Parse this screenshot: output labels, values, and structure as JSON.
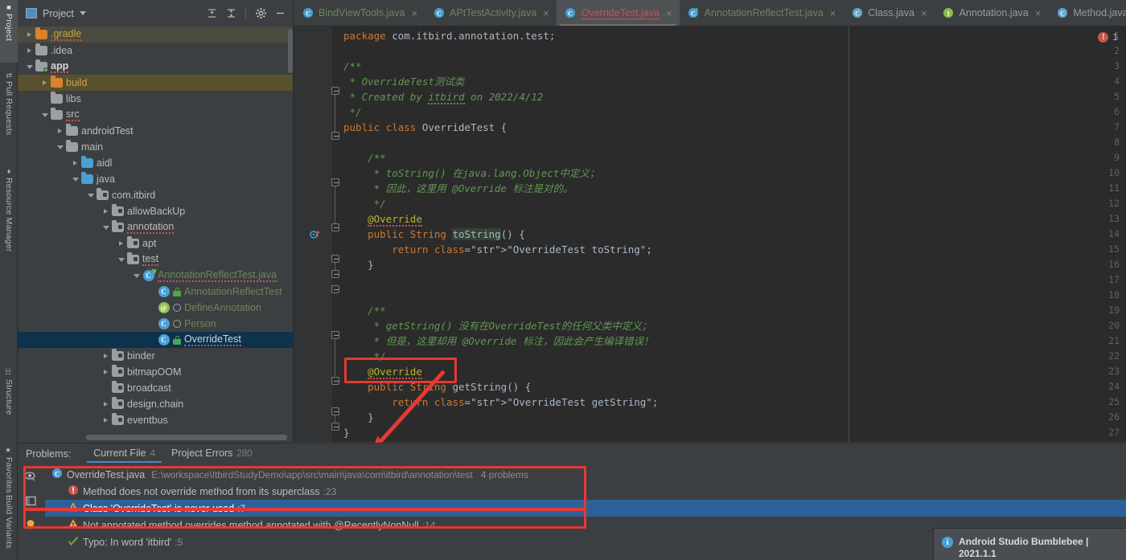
{
  "left_strip": [
    {
      "label": "Project",
      "icon": "project-icon",
      "selected": true
    },
    {
      "label": "Pull Requests",
      "icon": "pull-request-icon",
      "selected": false
    },
    {
      "label": "Resource Manager",
      "icon": "resource-manager-icon",
      "selected": false
    },
    {
      "label": "Structure",
      "icon": "structure-icon",
      "selected": false
    },
    {
      "label": "Favorites",
      "icon": "star-icon",
      "selected": false
    },
    {
      "label": "Build Variants",
      "icon": "build-variants-icon",
      "selected": false
    }
  ],
  "project_panel": {
    "title": "Project",
    "tools": [
      "expand-all-icon",
      "collapse-all-icon",
      "settings-gear-icon",
      "minimize-icon"
    ],
    "root": {
      "name": "ItbirdStudyDemo",
      "path": "E:\\workspace\\ItbirdStudyDemo"
    },
    "tree": [
      {
        "label": ".gradle",
        "indent": 0,
        "arrow": "closed",
        "icon": "folder-orange",
        "color": "gold",
        "row": "hl-project"
      },
      {
        "label": ".idea",
        "indent": 0,
        "arrow": "closed",
        "icon": "folder-gray",
        "color": "white",
        "row": ""
      },
      {
        "label": "app",
        "indent": 0,
        "arrow": "open",
        "icon": "folder-module",
        "color": "bold",
        "row": ""
      },
      {
        "label": "build",
        "indent": 1,
        "arrow": "closed",
        "icon": "folder-orange",
        "color": "gold",
        "row": "hl-build"
      },
      {
        "label": "libs",
        "indent": 1,
        "arrow": "none",
        "icon": "folder-gray",
        "color": "white",
        "row": ""
      },
      {
        "label": "src",
        "indent": 1,
        "arrow": "open",
        "icon": "folder-gray",
        "color": "white",
        "row": ""
      },
      {
        "label": "androidTest",
        "indent": 2,
        "arrow": "closed",
        "icon": "folder-gray",
        "color": "white",
        "row": ""
      },
      {
        "label": "main",
        "indent": 2,
        "arrow": "open",
        "icon": "folder-gray",
        "color": "white",
        "row": ""
      },
      {
        "label": "aidl",
        "indent": 3,
        "arrow": "closed",
        "icon": "folder-blue",
        "color": "white",
        "row": ""
      },
      {
        "label": "java",
        "indent": 3,
        "arrow": "open",
        "icon": "folder-blue",
        "color": "white",
        "row": ""
      },
      {
        "label": "com.itbird",
        "indent": 4,
        "arrow": "open",
        "icon": "folder-pkg",
        "color": "white",
        "row": ""
      },
      {
        "label": "allowBackUp",
        "indent": 5,
        "arrow": "closed",
        "icon": "folder-pkg",
        "color": "white",
        "row": ""
      },
      {
        "label": "annotation",
        "indent": 5,
        "arrow": "open",
        "icon": "folder-pkg",
        "color": "white",
        "row": ""
      },
      {
        "label": "apt",
        "indent": 6,
        "arrow": "closed",
        "icon": "folder-pkg",
        "color": "white",
        "row": ""
      },
      {
        "label": "test",
        "indent": 6,
        "arrow": "open",
        "icon": "folder-pkg",
        "color": "white",
        "row": ""
      },
      {
        "label": "AnnotationReflectTest.java",
        "indent": 7,
        "arrow": "open",
        "icon": "class-run-badge",
        "color": "green",
        "row": ""
      },
      {
        "label": "AnnotationReflectTest",
        "indent": 8,
        "arrow": "none",
        "icon": "class-lock",
        "color": "green",
        "row": ""
      },
      {
        "label": "DefineAnnotation",
        "indent": 8,
        "arrow": "none",
        "icon": "at-circle",
        "color": "green",
        "row": ""
      },
      {
        "label": "Person",
        "indent": 8,
        "arrow": "none",
        "icon": "class-circle",
        "color": "green",
        "row": ""
      },
      {
        "label": "OverrideTest",
        "indent": 8,
        "arrow": "none",
        "icon": "class-lock",
        "color": "sel",
        "row": "sel"
      },
      {
        "label": "binder",
        "indent": 5,
        "arrow": "closed",
        "icon": "folder-pkg",
        "color": "white",
        "row": ""
      },
      {
        "label": "bitmapOOM",
        "indent": 5,
        "arrow": "closed",
        "icon": "folder-pkg",
        "color": "white",
        "row": ""
      },
      {
        "label": "broadcast",
        "indent": 5,
        "arrow": "none",
        "icon": "folder-pkg",
        "color": "white",
        "row": ""
      },
      {
        "label": "design.chain",
        "indent": 5,
        "arrow": "closed",
        "icon": "folder-pkg",
        "color": "white",
        "row": ""
      },
      {
        "label": "eventbus",
        "indent": 5,
        "arrow": "closed",
        "icon": "folder-pkg",
        "color": "white",
        "row": ""
      }
    ]
  },
  "editor_tabs": [
    {
      "label": "BindViewTools.java",
      "icon": "class-icon",
      "color": "green",
      "active": false,
      "close": "×"
    },
    {
      "label": "APtTestActivity.java",
      "icon": "class-icon",
      "color": "green",
      "active": false,
      "close": "×"
    },
    {
      "label": "OverrideTest.java",
      "icon": "class-icon",
      "color": "red",
      "active": true,
      "close": "×"
    },
    {
      "label": "AnnotationReflectTest.java",
      "icon": "class-run-icon",
      "color": "green",
      "active": false,
      "close": "×"
    },
    {
      "label": "Class.java",
      "icon": "class-lib-icon",
      "color": "gray",
      "active": false,
      "close": "×"
    },
    {
      "label": "Annotation.java",
      "icon": "interface-icon",
      "color": "gray",
      "active": false,
      "close": "×"
    },
    {
      "label": "Method.java",
      "icon": "class-lib-icon",
      "color": "gray",
      "active": false,
      "close": "×"
    }
  ],
  "editor": {
    "error_count": "1",
    "error_icon": "error-circle-icon",
    "line_numbers": [
      "1",
      "2",
      "3",
      "4",
      "5",
      "6",
      "7",
      "8",
      "9",
      "10",
      "11",
      "12",
      "13",
      "14",
      "15",
      "16",
      "17",
      "18",
      "19",
      "20",
      "21",
      "22",
      "23",
      "24",
      "25",
      "26",
      "27"
    ],
    "code_lines": [
      "package com.itbird.annotation.test;",
      "",
      "/**",
      " * OverrideTest测试类",
      " * Created by itbird on 2022/4/12",
      " */",
      "public class OverrideTest {",
      "",
      "    /**",
      "     * toString() 在java.lang.Object中定义；",
      "     * 因此，这里用 @Override 标注是对的。",
      "     */",
      "    @Override",
      "    public String toString() {",
      "        return \"OverrideTest toString\";",
      "    }",
      "",
      "",
      "    /**",
      "     * getString() 没有在OverrideTest的任何父类中定义；",
      "     * 但是，这里却用 @Override 标注，因此会产生编译错误！",
      "     */",
      "    @Override",
      "    public String getString() {",
      "        return \"OverrideTest getString\";",
      "    }",
      "}"
    ]
  },
  "problems": {
    "label": "Problems:",
    "tabs": [
      {
        "label": "Current File",
        "count": "4",
        "active": true
      },
      {
        "label": "Project Errors",
        "count": "280",
        "active": false
      }
    ],
    "side_icons": [
      "eye-icon",
      "panel-layout-icon",
      "lightbulb-icon"
    ],
    "items": [
      {
        "level": "file",
        "icon": "class-icon",
        "text": "OverrideTest.java",
        "path": "E:\\workspace\\ItbirdStudyDemo\\app\\src\\main\\java\\com\\itbird\\annotation\\test",
        "count": "4 problems",
        "line": "",
        "selected": false,
        "indent": 0
      },
      {
        "level": "error",
        "icon": "error-icon",
        "text": "Method does not override method from its superclass",
        "path": "",
        "count": "",
        "line": ":23",
        "selected": false,
        "indent": 1
      },
      {
        "level": "warning",
        "icon": "warning-icon",
        "text": "Class 'OverrideTest' is never used",
        "path": "",
        "count": "",
        "line": ":7",
        "selected": true,
        "indent": 1
      },
      {
        "level": "warning",
        "icon": "warning-icon",
        "text": "Not annotated method overrides method annotated with @RecentlyNonNull",
        "path": "",
        "count": "",
        "line": ":14",
        "selected": false,
        "indent": 1
      },
      {
        "level": "typo",
        "icon": "typo-icon",
        "text": "Typo: In word 'itbird'",
        "path": "",
        "count": "",
        "line": ":5",
        "selected": false,
        "indent": 1
      }
    ]
  },
  "toast": {
    "icon": "info-icon",
    "text": "Android Studio Bumblebee | 2021.1.1"
  },
  "colors": {
    "accent_blue": "#4a88c7",
    "selection_blue": "#2d6099",
    "tree_selection": "#0d324d",
    "error_red": "#c75450",
    "annotation_red": "#e53935",
    "warning_yellow": "#e8a33d",
    "comment_green": "#629755",
    "keyword_orange": "#cc7832",
    "string_green": "#6a8759",
    "annotation_yellow": "#bbb529",
    "panel_bg": "#3c3f41",
    "editor_bg": "#2b2b2b",
    "gutter_bg": "#313335"
  }
}
